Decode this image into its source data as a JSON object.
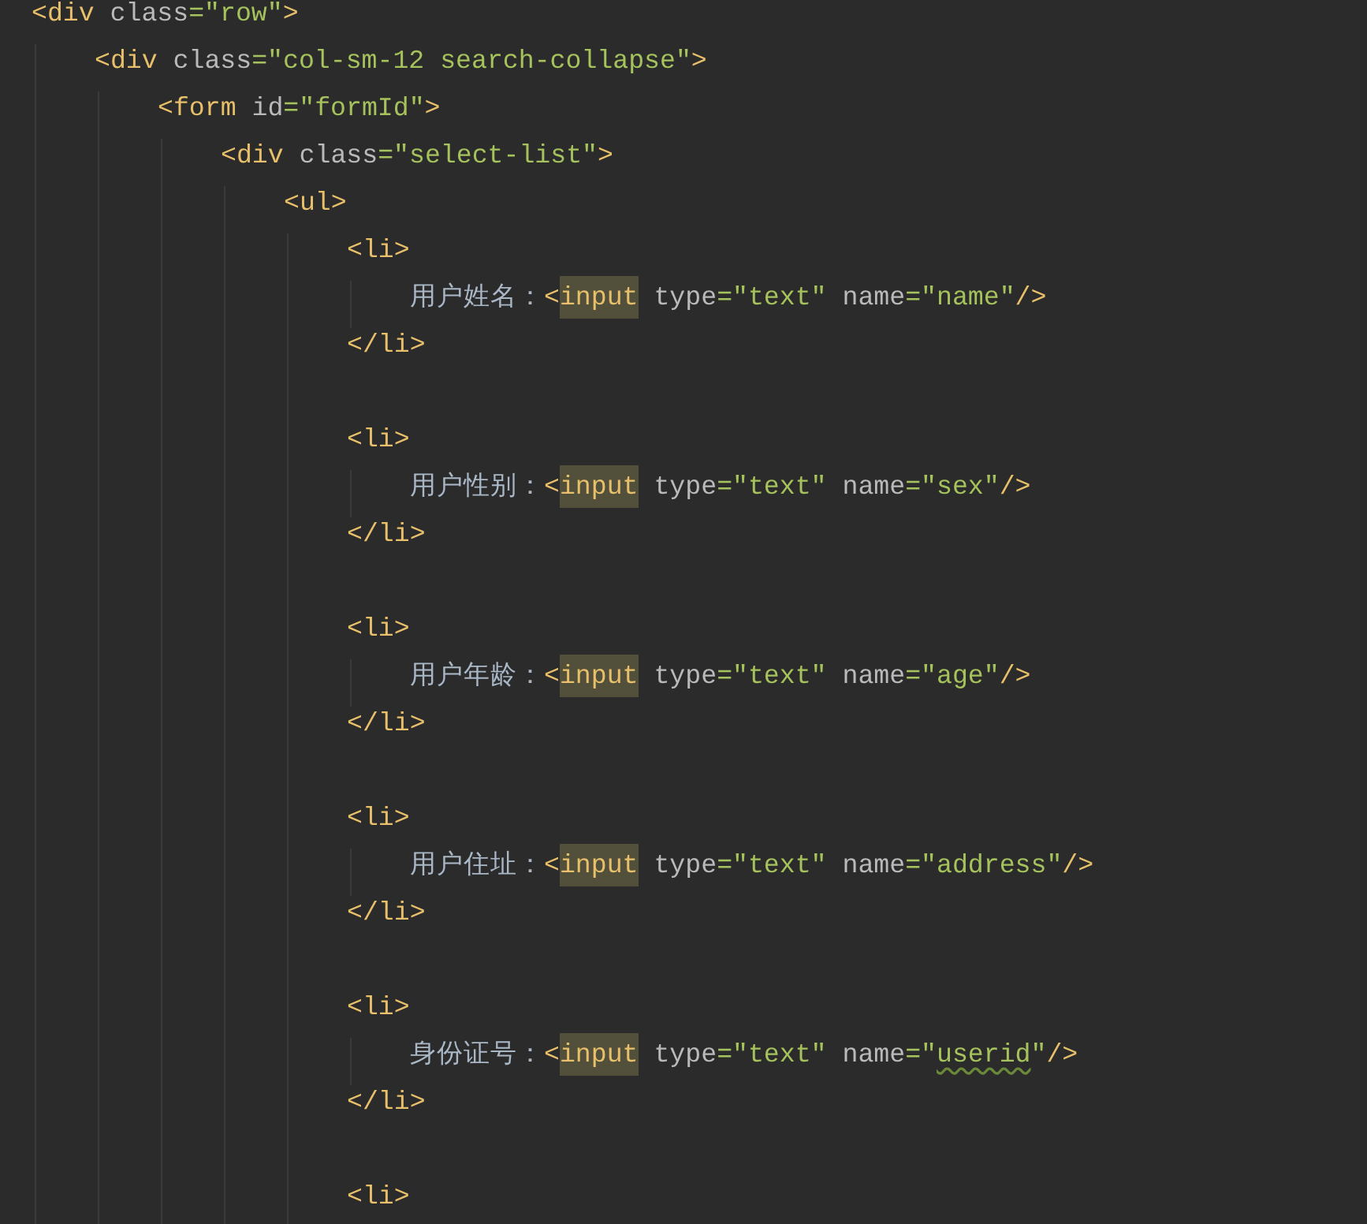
{
  "editor": {
    "lines": [
      {
        "kind": "code",
        "tokens": [
          {
            "kind": "tag",
            "text": "<div"
          },
          {
            "kind": "attr",
            "text": " class"
          },
          {
            "kind": "value",
            "text": "=\"row\""
          },
          {
            "kind": "tag",
            "text": ">"
          }
        ],
        "children": [
          {
            "kind": "code",
            "tokens": [
              {
                "kind": "tag",
                "text": "<div"
              },
              {
                "kind": "attr",
                "text": " class"
              },
              {
                "kind": "value",
                "text": "=\"col-sm-12 search-collapse\""
              },
              {
                "kind": "tag",
                "text": ">"
              }
            ],
            "children": [
              {
                "kind": "code",
                "tokens": [
                  {
                    "kind": "tag",
                    "text": "<form"
                  },
                  {
                    "kind": "attr",
                    "text": " id"
                  },
                  {
                    "kind": "value",
                    "text": "=\"formId\""
                  },
                  {
                    "kind": "tag",
                    "text": ">"
                  }
                ],
                "children": [
                  {
                    "kind": "code",
                    "tokens": [
                      {
                        "kind": "tag",
                        "text": "<div"
                      },
                      {
                        "kind": "attr",
                        "text": " class"
                      },
                      {
                        "kind": "value",
                        "text": "=\"select-list\""
                      },
                      {
                        "kind": "tag",
                        "text": ">"
                      }
                    ],
                    "children": [
                      {
                        "kind": "code",
                        "tokens": [
                          {
                            "kind": "tag",
                            "text": "<ul>"
                          }
                        ],
                        "children": [
                          {
                            "kind": "code",
                            "tokens": [
                              {
                                "kind": "tag",
                                "text": "<li>"
                              }
                            ],
                            "children": [
                              {
                                "kind": "code",
                                "tokens": [
                                  {
                                    "kind": "text",
                                    "text": "用户姓名："
                                  },
                                  {
                                    "kind": "tag",
                                    "text": "<"
                                  },
                                  {
                                    "kind": "match",
                                    "text": "input"
                                  },
                                  {
                                    "kind": "attr",
                                    "text": " type"
                                  },
                                  {
                                    "kind": "value",
                                    "text": "=\"text\""
                                  },
                                  {
                                    "kind": "attr",
                                    "text": " name"
                                  },
                                  {
                                    "kind": "value",
                                    "text": "=\"name\""
                                  },
                                  {
                                    "kind": "tag",
                                    "text": "/>"
                                  }
                                ]
                              }
                            ]
                          },
                          {
                            "kind": "code",
                            "tokens": [
                              {
                                "kind": "tag",
                                "text": "</li>"
                              }
                            ]
                          },
                          {
                            "kind": "blank"
                          },
                          {
                            "kind": "code",
                            "tokens": [
                              {
                                "kind": "tag",
                                "text": "<li>"
                              }
                            ],
                            "children": [
                              {
                                "kind": "code",
                                "tokens": [
                                  {
                                    "kind": "text",
                                    "text": "用户性别："
                                  },
                                  {
                                    "kind": "tag",
                                    "text": "<"
                                  },
                                  {
                                    "kind": "match",
                                    "text": "input"
                                  },
                                  {
                                    "kind": "attr",
                                    "text": " type"
                                  },
                                  {
                                    "kind": "value",
                                    "text": "=\"text\""
                                  },
                                  {
                                    "kind": "attr",
                                    "text": " name"
                                  },
                                  {
                                    "kind": "value",
                                    "text": "=\"sex\""
                                  },
                                  {
                                    "kind": "tag",
                                    "text": "/>"
                                  }
                                ]
                              }
                            ]
                          },
                          {
                            "kind": "code",
                            "tokens": [
                              {
                                "kind": "tag",
                                "text": "</li>"
                              }
                            ]
                          },
                          {
                            "kind": "blank"
                          },
                          {
                            "kind": "code",
                            "tokens": [
                              {
                                "kind": "tag",
                                "text": "<li>"
                              }
                            ],
                            "children": [
                              {
                                "kind": "code",
                                "tokens": [
                                  {
                                    "kind": "text",
                                    "text": "用户年龄："
                                  },
                                  {
                                    "kind": "tag",
                                    "text": "<"
                                  },
                                  {
                                    "kind": "match",
                                    "text": "input"
                                  },
                                  {
                                    "kind": "attr",
                                    "text": " type"
                                  },
                                  {
                                    "kind": "value",
                                    "text": "=\"text\""
                                  },
                                  {
                                    "kind": "attr",
                                    "text": " name"
                                  },
                                  {
                                    "kind": "value",
                                    "text": "=\"age\""
                                  },
                                  {
                                    "kind": "tag",
                                    "text": "/>"
                                  }
                                ]
                              }
                            ]
                          },
                          {
                            "kind": "code",
                            "tokens": [
                              {
                                "kind": "tag",
                                "text": "</li>"
                              }
                            ]
                          },
                          {
                            "kind": "blank"
                          },
                          {
                            "kind": "code",
                            "tokens": [
                              {
                                "kind": "tag",
                                "text": "<li>"
                              }
                            ],
                            "children": [
                              {
                                "kind": "code",
                                "tokens": [
                                  {
                                    "kind": "text",
                                    "text": "用户住址："
                                  },
                                  {
                                    "kind": "tag",
                                    "text": "<"
                                  },
                                  {
                                    "kind": "match",
                                    "text": "input"
                                  },
                                  {
                                    "kind": "attr",
                                    "text": " type"
                                  },
                                  {
                                    "kind": "value",
                                    "text": "=\"text\""
                                  },
                                  {
                                    "kind": "attr",
                                    "text": " name"
                                  },
                                  {
                                    "kind": "value",
                                    "text": "=\"address\""
                                  },
                                  {
                                    "kind": "tag",
                                    "text": "/>"
                                  }
                                ]
                              }
                            ]
                          },
                          {
                            "kind": "code",
                            "tokens": [
                              {
                                "kind": "tag",
                                "text": "</li>"
                              }
                            ]
                          },
                          {
                            "kind": "blank"
                          },
                          {
                            "kind": "code",
                            "tokens": [
                              {
                                "kind": "tag",
                                "text": "<li>"
                              }
                            ],
                            "children": [
                              {
                                "kind": "code",
                                "tokens": [
                                  {
                                    "kind": "text",
                                    "text": "身份证号："
                                  },
                                  {
                                    "kind": "tag",
                                    "text": "<"
                                  },
                                  {
                                    "kind": "match",
                                    "text": "input"
                                  },
                                  {
                                    "kind": "attr",
                                    "text": " type"
                                  },
                                  {
                                    "kind": "value",
                                    "text": "=\"text\""
                                  },
                                  {
                                    "kind": "attr",
                                    "text": " name"
                                  },
                                  {
                                    "kind": "value",
                                    "text": "=\""
                                  },
                                  {
                                    "kind": "typo",
                                    "text": "userid"
                                  },
                                  {
                                    "kind": "value",
                                    "text": "\""
                                  },
                                  {
                                    "kind": "tag",
                                    "text": "/>"
                                  }
                                ]
                              }
                            ]
                          },
                          {
                            "kind": "code",
                            "tokens": [
                              {
                                "kind": "tag",
                                "text": "</li>"
                              }
                            ]
                          },
                          {
                            "kind": "blank"
                          },
                          {
                            "kind": "code",
                            "tokens": [
                              {
                                "kind": "tag",
                                "text": "<li>"
                              }
                            ]
                          }
                        ]
                      }
                    ]
                  }
                ]
              }
            ]
          }
        ]
      }
    ]
  }
}
